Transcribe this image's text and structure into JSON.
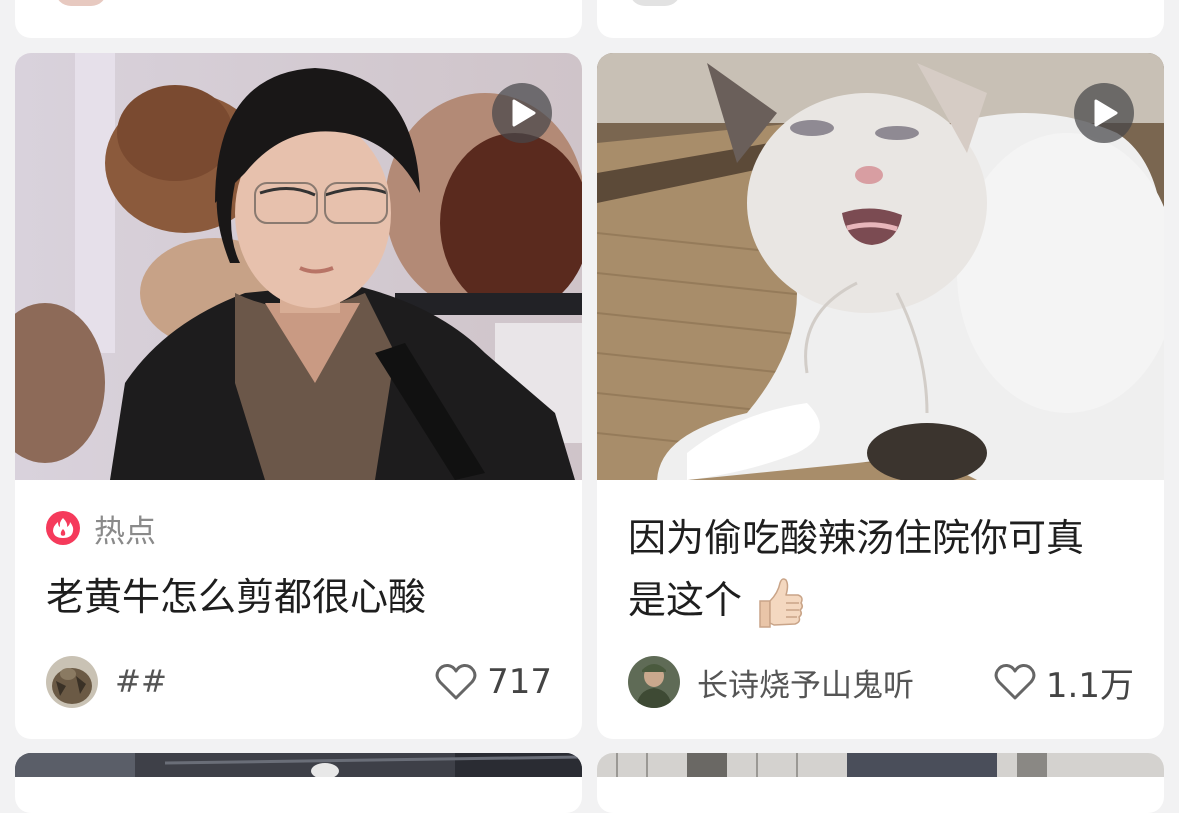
{
  "feed": {
    "cards": [
      {
        "hot_label": "热点",
        "title": "老黄牛怎么剪都很心酸",
        "author": "##",
        "likes": "717",
        "has_video": true
      },
      {
        "title_line1": "因为偷吃酸辣汤住院你可真",
        "title_line2": "是这个",
        "author": "长诗烧予山鬼听",
        "likes": "1.1万",
        "has_video": true
      }
    ]
  },
  "colors": {
    "background": "#f2f2f3",
    "hot_badge": "#f53a5b",
    "card": "#ffffff"
  },
  "icons": {
    "play": "play-icon",
    "hot": "fire-icon",
    "like": "heart-outline-icon",
    "emoji": "thumbs-up-emoji"
  }
}
